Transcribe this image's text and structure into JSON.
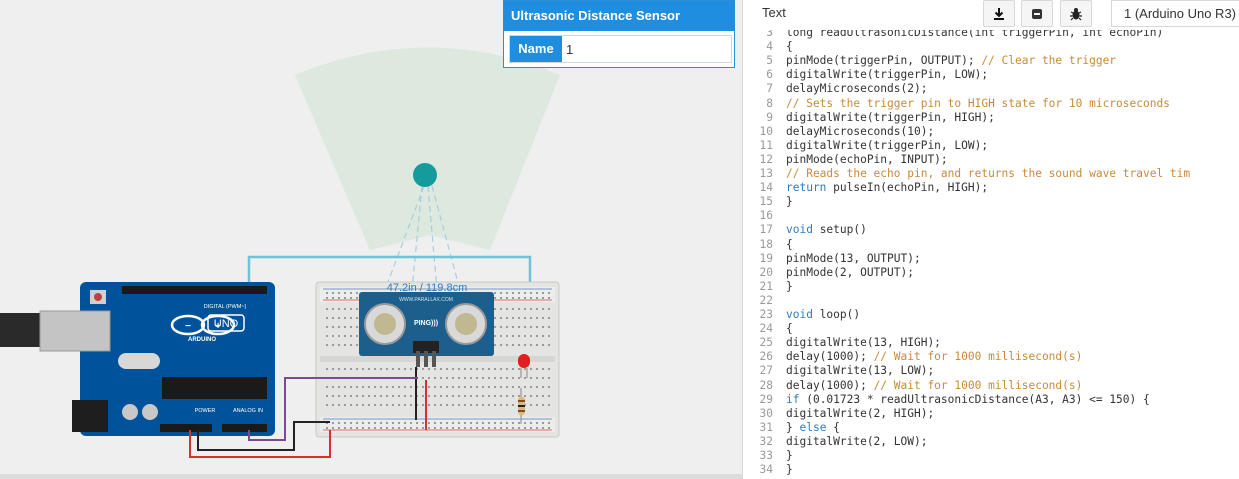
{
  "properties_panel": {
    "title": "Ultrasonic Distance Sensor",
    "name_label": "Name",
    "name_value": "1"
  },
  "circuit": {
    "distance_readout": "47.2in / 119.8cm",
    "arduino_logo": "UNO",
    "arduino_brand": "ARDUINO",
    "digital_label": "DIGITAL (PWM~)",
    "power_label": "POWER",
    "analog_label": "ANALOG IN",
    "sensor_label": "PING)))",
    "sensor_brand": "WWW.PARALLAX.COM"
  },
  "code_panel": {
    "mode_label": "Text",
    "board_label": "1 (Arduino Uno R3)",
    "toolbar": [
      {
        "icon": "download-icon"
      },
      {
        "icon": "upload-to-board-icon"
      },
      {
        "icon": "bug-debugger-icon"
      }
    ],
    "lines": [
      {
        "num": "3",
        "text": "long readUltrasonicDistance(int triggerPin, int echoPin)",
        "kind": "txt"
      },
      {
        "num": "4",
        "text": "{",
        "kind": "txt"
      },
      {
        "num": "5",
        "text": "pinMode(triggerPin, OUTPUT); // Clear the trigger",
        "kind": "mixed",
        "code": "pinMode(triggerPin, OUTPUT); ",
        "comment": "// Clear the trigger"
      },
      {
        "num": "6",
        "text": "digitalWrite(triggerPin, LOW);",
        "kind": "txt"
      },
      {
        "num": "7",
        "text": "delayMicroseconds(2);",
        "kind": "txt"
      },
      {
        "num": "8",
        "text": "// Sets the trigger pin to HIGH state for 10 microseconds",
        "kind": "cm"
      },
      {
        "num": "9",
        "text": "digitalWrite(triggerPin, HIGH);",
        "kind": "txt"
      },
      {
        "num": "10",
        "text": "delayMicroseconds(10);",
        "kind": "txt"
      },
      {
        "num": "11",
        "text": "digitalWrite(triggerPin, LOW);",
        "kind": "txt"
      },
      {
        "num": "12",
        "text": "pinMode(echoPin, INPUT);",
        "kind": "txt"
      },
      {
        "num": "13",
        "text": "// Reads the echo pin, and returns the sound wave travel tim",
        "kind": "cm"
      },
      {
        "num": "14",
        "text": "return pulseIn(echoPin, HIGH);",
        "kind": "kwstart",
        "kw": "return",
        "rest": " pulseIn(echoPin, HIGH);"
      },
      {
        "num": "15",
        "text": "}",
        "kind": "txt"
      },
      {
        "num": "16",
        "text": "",
        "kind": "txt"
      },
      {
        "num": "17",
        "text": "void setup()",
        "kind": "kwstart",
        "kw": "void",
        "rest": " setup()"
      },
      {
        "num": "18",
        "text": "{",
        "kind": "txt"
      },
      {
        "num": "19",
        "text": "pinMode(13, OUTPUT);",
        "kind": "txt"
      },
      {
        "num": "20",
        "text": "pinMode(2, OUTPUT);",
        "kind": "txt"
      },
      {
        "num": "21",
        "text": "}",
        "kind": "txt"
      },
      {
        "num": "22",
        "text": "",
        "kind": "txt"
      },
      {
        "num": "23",
        "text": "void loop()",
        "kind": "kwstart",
        "kw": "void",
        "rest": " loop()"
      },
      {
        "num": "24",
        "text": "{",
        "kind": "txt"
      },
      {
        "num": "25",
        "text": "digitalWrite(13, HIGH);",
        "kind": "txt"
      },
      {
        "num": "26",
        "text": "delay(1000); // Wait for 1000 millisecond(s)",
        "kind": "mixed",
        "code": "delay(1000); ",
        "comment": "// Wait for 1000 millisecond(s)"
      },
      {
        "num": "27",
        "text": "digitalWrite(13, LOW);",
        "kind": "txt"
      },
      {
        "num": "28",
        "text": "delay(1000); // Wait for 1000 millisecond(s)",
        "kind": "mixed",
        "code": "delay(1000); ",
        "comment": "// Wait for 1000 millisecond(s)"
      },
      {
        "num": "29",
        "text": "if (0.01723 * readUltrasonicDistance(A3, A3) <= 150) {",
        "kind": "kwstart",
        "kw": "if",
        "rest": " (0.01723 * readUltrasonicDistance(A3, A3) <= 150) {"
      },
      {
        "num": "30",
        "text": "digitalWrite(2, HIGH);",
        "kind": "txt"
      },
      {
        "num": "31",
        "text": "} else {",
        "kind": "kwmid",
        "pre": "} ",
        "kw": "else",
        "rest": " {"
      },
      {
        "num": "32",
        "text": "digitalWrite(2, LOW);",
        "kind": "txt"
      },
      {
        "num": "33",
        "text": "}",
        "kind": "txt"
      },
      {
        "num": "34",
        "text": "}",
        "kind": "txt"
      }
    ]
  },
  "colors": {
    "accent": "#1f8ee0",
    "board": "#00539b",
    "wire_cyan": "#6ec3d6",
    "wire_red": "#d63030",
    "wire_purple": "#7a4a99",
    "wire_black": "#222222",
    "sensor_target": "#149c9c"
  }
}
